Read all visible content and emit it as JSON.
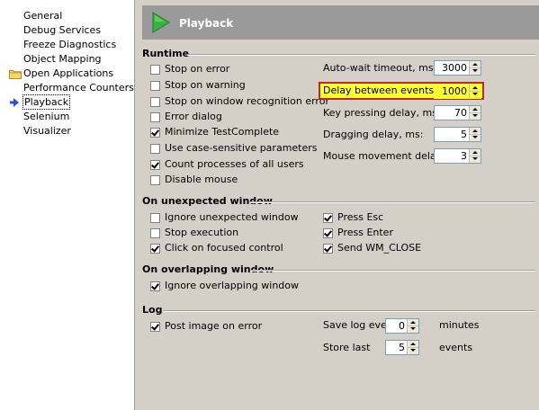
{
  "tree": {
    "items": [
      {
        "label": "General"
      },
      {
        "label": "Debug Services"
      },
      {
        "label": "Freeze Diagnostics"
      },
      {
        "label": "Object Mapping"
      },
      {
        "label": "Open Applications"
      },
      {
        "label": "Performance Counters"
      },
      {
        "label": "Playback",
        "selected": true
      },
      {
        "label": "Selenium"
      },
      {
        "label": "Visualizer"
      }
    ]
  },
  "header": {
    "title": "Playback"
  },
  "runtime": {
    "title": "Runtime",
    "checkboxes": [
      {
        "label": "Stop on error",
        "checked": false
      },
      {
        "label": "Stop on warning",
        "checked": false
      },
      {
        "label": "Stop on window recognition error",
        "checked": false
      },
      {
        "label": "Error dialog",
        "checked": false
      },
      {
        "label": "Minimize TestComplete",
        "checked": true
      },
      {
        "label": "Use case-sensitive parameters",
        "checked": false
      },
      {
        "label": "Count processes of all users",
        "checked": true
      },
      {
        "label": "Disable mouse",
        "checked": false
      }
    ],
    "fields": [
      {
        "label": "Auto-wait timeout, ms:",
        "value": "3000"
      },
      {
        "label": "Delay between events, ms:",
        "value": "1000"
      },
      {
        "label": "Key pressing delay, ms:",
        "value": "70"
      },
      {
        "label": "Dragging delay, ms:",
        "value": "5"
      },
      {
        "label": "Mouse movement delay, ms:",
        "value": "3"
      }
    ]
  },
  "unexpected": {
    "title": "On unexpected window",
    "left": [
      {
        "label": "Ignore unexpected window",
        "checked": false
      },
      {
        "label": "Stop execution",
        "checked": false
      },
      {
        "label": "Click on focused control",
        "checked": true
      }
    ],
    "right": [
      {
        "label": "Press Esc",
        "checked": true
      },
      {
        "label": "Press Enter",
        "checked": true
      },
      {
        "label": "Send WM_CLOSE",
        "checked": true
      }
    ]
  },
  "overlapping": {
    "title": "On overlapping window",
    "checkbox": {
      "label": "Ignore overlapping window",
      "checked": true
    }
  },
  "log": {
    "title": "Log",
    "checkbox": {
      "label": "Post image on error",
      "checked": true
    },
    "save_label": "Save log every",
    "save_value": "0",
    "save_unit": "minutes",
    "store_label": "Store last",
    "store_value": "5",
    "store_unit": "events"
  },
  "icons": {
    "folder": "folder-icon",
    "selected_arrow": "arrow-right-icon",
    "header": "play-arrow-icon"
  },
  "colors": {
    "header_bg": "#9a9a9a",
    "play_green": "#3cb043",
    "highlight_fill": "#ffff33",
    "highlight_border": "#c0262d"
  }
}
